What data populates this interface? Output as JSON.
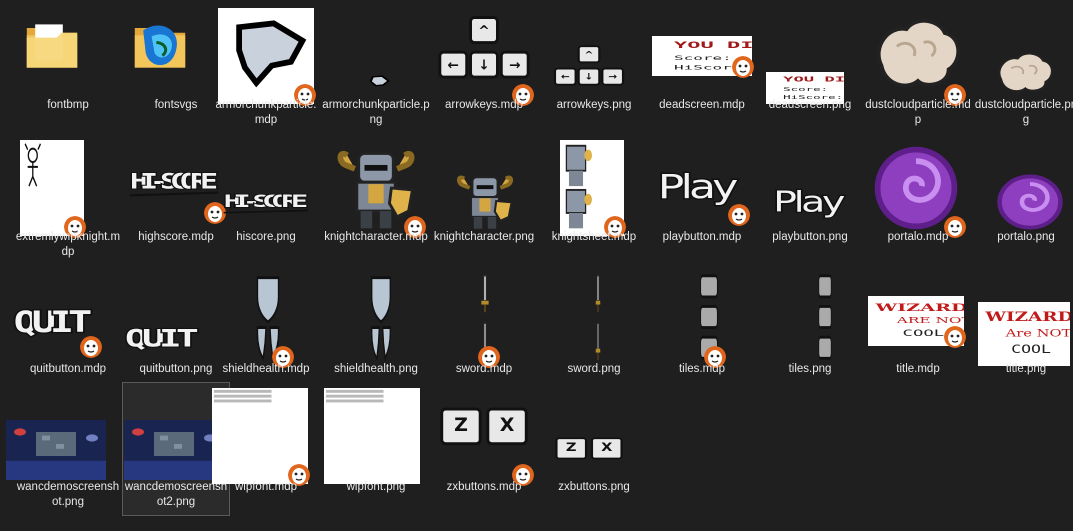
{
  "colors": {
    "background": "#1f1f1f",
    "label": "#e8e8e8",
    "folder": "#f3c65b",
    "badge_orange": "#e0651d"
  },
  "files": [
    {
      "id": "fontbmp",
      "label": "fontbmp",
      "kind": "folder",
      "icon": "folder-icon"
    },
    {
      "id": "fontsvgs",
      "label": "fontsvgs",
      "kind": "folder",
      "icon": "folder-app-icon"
    },
    {
      "id": "armorchunkparticle-mdp",
      "label": "armorchunkparticle.mdp",
      "kind": "mdp",
      "icon": "armor-chunk-icon"
    },
    {
      "id": "armorchunkparticle-png",
      "label": "armorchunkparticle.png",
      "kind": "png",
      "icon": "armor-chunk-small-icon"
    },
    {
      "id": "arrowkeys-mdp",
      "label": "arrowkeys.mdp",
      "kind": "mdp",
      "icon": "arrow-keys-icon"
    },
    {
      "id": "arrowkeys-png",
      "label": "arrowkeys.png",
      "kind": "png",
      "icon": "arrow-keys-icon"
    },
    {
      "id": "deadscreen-mdp",
      "label": "deadscreen.mdp",
      "kind": "mdp",
      "icon": "you-died-icon",
      "thumb_text": {
        "title": "YOU DIED",
        "line1": "Score:",
        "line2": "HiScore:"
      }
    },
    {
      "id": "deadscreen-png",
      "label": "deadscreen.png",
      "kind": "png",
      "icon": "you-died-icon",
      "thumb_text": {
        "title": "YOU DIED",
        "line1": "Score:",
        "line2": "HiScore:"
      }
    },
    {
      "id": "dustcloudparticle-mdp",
      "label": "dustcloudparticle.mdp",
      "kind": "mdp",
      "icon": "dust-cloud-icon"
    },
    {
      "id": "dustcloudparticle-png",
      "label": "dustcloudparticle.png",
      "kind": "png",
      "icon": "dust-cloud-icon"
    },
    {
      "id": "extremlywipknight-mdp",
      "label": "extremlywipknight.mdp",
      "kind": "mdp",
      "icon": "stick-knight-icon"
    },
    {
      "id": "highscore-mdp",
      "label": "highscore.mdp",
      "kind": "mdp",
      "icon": "hi-score-icon",
      "thumb_text": {
        "title": "HI-SCORE"
      }
    },
    {
      "id": "hiscore-png",
      "label": "hiscore.png",
      "kind": "png",
      "icon": "hi-score-icon",
      "thumb_text": {
        "title": "HI-SCORE"
      }
    },
    {
      "id": "knightcharacter-mdp",
      "label": "knightcharacter.mdp",
      "kind": "mdp",
      "icon": "knight-icon"
    },
    {
      "id": "knightcharacter-png",
      "label": "knightcharacter.png",
      "kind": "png",
      "icon": "knight-icon"
    },
    {
      "id": "knightsheet-mdp",
      "label": "knightsheet.mdp",
      "kind": "mdp",
      "icon": "knight-sheet-icon"
    },
    {
      "id": "playbutton-mdp",
      "label": "playbutton.mdp",
      "kind": "mdp",
      "icon": "play-button-icon",
      "thumb_text": {
        "title": "Play"
      }
    },
    {
      "id": "playbutton-png",
      "label": "playbutton.png",
      "kind": "png",
      "icon": "play-button-icon",
      "thumb_text": {
        "title": "Play"
      }
    },
    {
      "id": "portalo-mdp",
      "label": "portalo.mdp",
      "kind": "mdp",
      "icon": "portal-icon"
    },
    {
      "id": "portalo-png",
      "label": "portalo.png",
      "kind": "png",
      "icon": "portal-icon"
    },
    {
      "id": "quitbutton-mdp",
      "label": "quitbutton.mdp",
      "kind": "mdp",
      "icon": "quit-button-icon",
      "thumb_text": {
        "title": "QUIT"
      }
    },
    {
      "id": "quitbutton-png",
      "label": "quitbutton.png",
      "kind": "png",
      "icon": "quit-button-icon",
      "thumb_text": {
        "title": "QUIT"
      }
    },
    {
      "id": "shieldhealth-mdp",
      "label": "shieldhealth.mdp",
      "kind": "mdp",
      "icon": "shield-icon"
    },
    {
      "id": "shieldhealth-png",
      "label": "shieldhealth.png",
      "kind": "png",
      "icon": "shield-icon"
    },
    {
      "id": "sword-mdp",
      "label": "sword.mdp",
      "kind": "mdp",
      "icon": "sword-icon"
    },
    {
      "id": "sword-png",
      "label": "sword.png",
      "kind": "png",
      "icon": "sword-icon"
    },
    {
      "id": "tiles-mdp",
      "label": "tiles.mdp",
      "kind": "mdp",
      "icon": "tiles-icon"
    },
    {
      "id": "tiles-png",
      "label": "tiles.png",
      "kind": "png",
      "icon": "tiles-icon"
    },
    {
      "id": "title-mdp",
      "label": "title.mdp",
      "kind": "mdp",
      "icon": "title-logo-icon",
      "thumb_text": {
        "line1": "WIZARDS",
        "line2": "ARE NOT",
        "line3": "COOL"
      }
    },
    {
      "id": "title-png",
      "label": "title.png",
      "kind": "png",
      "icon": "title-logo-icon",
      "thumb_text": {
        "line1": "WIZARDS",
        "line2": "Are NOT",
        "line3": "COOL"
      }
    },
    {
      "id": "wancdemoscreenshot-png",
      "label": "wancdemoscreenshot.png",
      "kind": "png",
      "icon": "screenshot-icon"
    },
    {
      "id": "wancdemoscreenshot2-png",
      "label": "wancdemoscreenshot2.png",
      "kind": "png",
      "icon": "screenshot-icon",
      "selected": true
    },
    {
      "id": "wipfont-mdp",
      "label": "wipfont.mdp",
      "kind": "mdp",
      "icon": "font-sheet-icon"
    },
    {
      "id": "wipfont-png",
      "label": "wipfont.png",
      "kind": "png",
      "icon": "font-sheet-icon"
    },
    {
      "id": "zxbuttons-mdp",
      "label": "zxbuttons.mdp",
      "kind": "mdp",
      "icon": "zx-keys-icon"
    },
    {
      "id": "zxbuttons-png",
      "label": "zxbuttons.png",
      "kind": "png",
      "icon": "zx-keys-icon"
    }
  ]
}
